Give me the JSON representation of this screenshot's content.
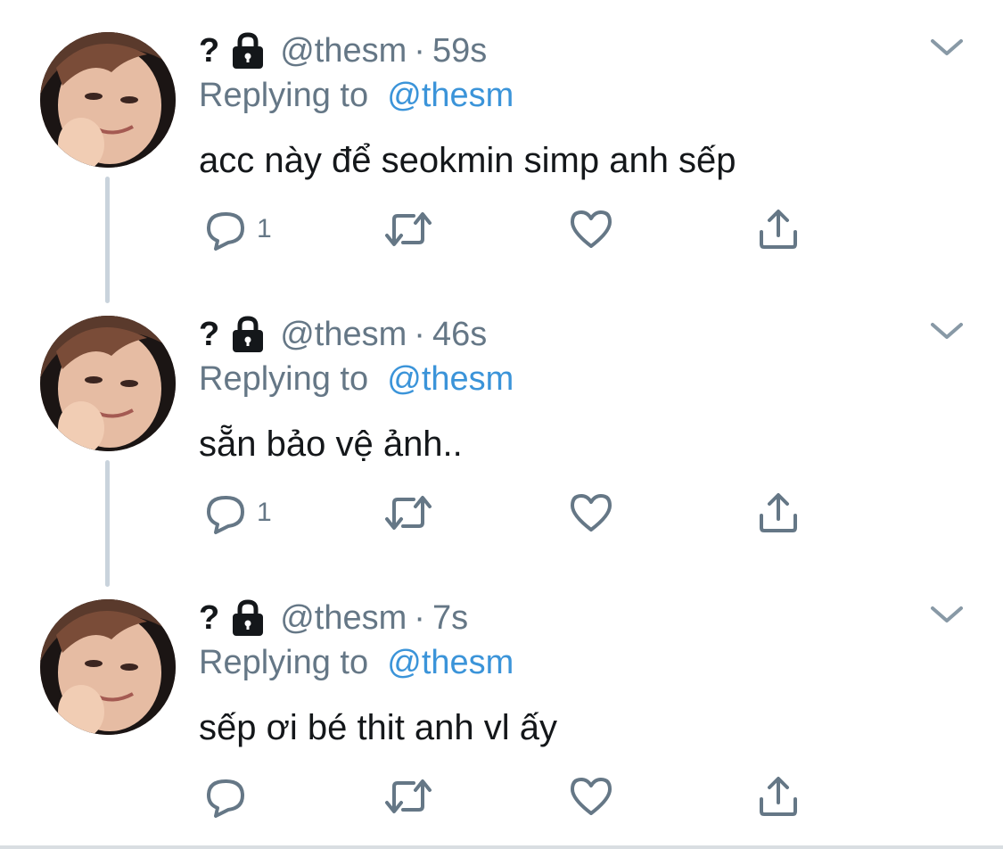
{
  "colors": {
    "text_primary": "#14171a",
    "text_secondary": "#657786",
    "mention": "#3b94d9",
    "thread_line": "#c9d3dc",
    "icon": "#657786"
  },
  "tweets": [
    {
      "name": "?",
      "locked_icon": "lock-icon",
      "handle": "@thesm",
      "separator": "·",
      "time": "59s",
      "replying_prefix": "Replying to",
      "replying_to": "@thesm",
      "text": "acc này để seokmin simp anh sếp",
      "reply_count": "1",
      "menu_icon": "chevron-down-icon"
    },
    {
      "name": "?",
      "locked_icon": "lock-icon",
      "handle": "@thesm",
      "separator": "·",
      "time": "46s",
      "replying_prefix": "Replying to",
      "replying_to": "@thesm",
      "text": "sẵn bảo vệ ảnh..",
      "reply_count": "1",
      "menu_icon": "chevron-down-icon"
    },
    {
      "name": "?",
      "locked_icon": "lock-icon",
      "handle": "@thesm",
      "separator": "·",
      "time": "7s",
      "replying_prefix": "Replying to",
      "replying_to": "@thesm",
      "text": "sếp ơi bé thit anh vl ấy",
      "reply_count": "",
      "menu_icon": "chevron-down-icon"
    }
  ]
}
